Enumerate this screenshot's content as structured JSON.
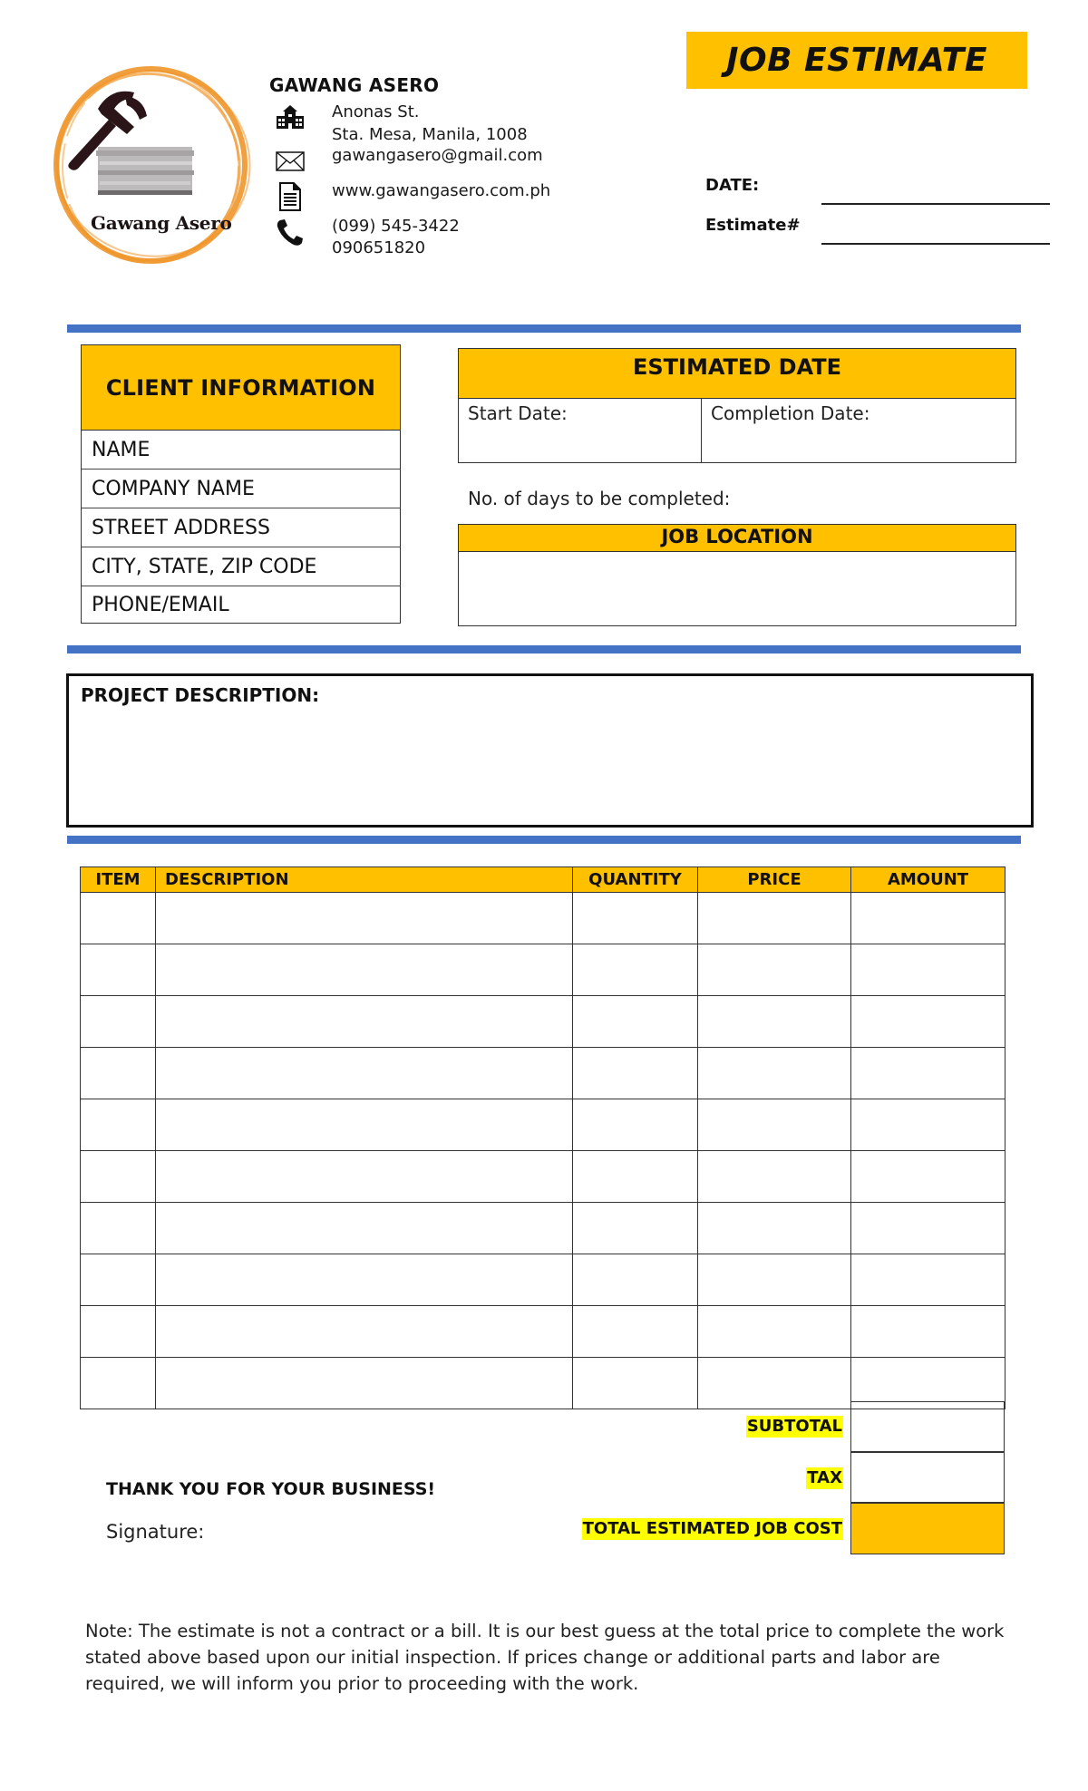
{
  "logo": {
    "text": "Gawang Asero",
    "ring_color": "#F0962A",
    "hammer_color": "#2B1518"
  },
  "company": {
    "name": "GAWANG ASERO",
    "address_line1": "Anonas St.",
    "address_line2": "Sta. Mesa, Manila, 1008",
    "email": "gawangasero@gmail.com",
    "website": "www.gawangasero.com.ph",
    "phone1": "(099) 545-3422",
    "phone2": "090651820",
    "icons": [
      "building-icon",
      "envelope-icon",
      "document-icon",
      "phone-icon"
    ]
  },
  "header": {
    "title": "JOB ESTIMATE",
    "date_label": "DATE:",
    "date_value": "",
    "estimate_label": "Estimate#",
    "estimate_value": ""
  },
  "client_info": {
    "title": "CLIENT INFORMATION",
    "fields": [
      "NAME",
      "COMPANY NAME",
      "STREET ADDRESS",
      "CITY, STATE, ZIP CODE",
      "PHONE/EMAIL"
    ]
  },
  "estimated_date": {
    "title": "ESTIMATED DATE",
    "start_label": "Start Date:",
    "completion_label": "Completion Date:",
    "days_label": "No. of days to be completed:"
  },
  "job_location": {
    "title": "JOB LOCATION",
    "value": ""
  },
  "project": {
    "label": "PROJECT DESCRIPTION:",
    "value": ""
  },
  "items_table": {
    "columns": [
      "ITEM",
      "DESCRIPTION",
      "QUANTITY",
      "PRICE",
      "AMOUNT"
    ],
    "rows": [
      [
        "",
        "",
        "",
        "",
        ""
      ],
      [
        "",
        "",
        "",
        "",
        ""
      ],
      [
        "",
        "",
        "",
        "",
        ""
      ],
      [
        "",
        "",
        "",
        "",
        ""
      ],
      [
        "",
        "",
        "",
        "",
        ""
      ],
      [
        "",
        "",
        "",
        "",
        ""
      ],
      [
        "",
        "",
        "",
        "",
        ""
      ],
      [
        "",
        "",
        "",
        "",
        ""
      ],
      [
        "",
        "",
        "",
        "",
        ""
      ],
      [
        "",
        "",
        "",
        "",
        ""
      ]
    ]
  },
  "totals": {
    "subtotal_label": "SUBTOTAL",
    "subtotal_value": "",
    "tax_label": "TAX",
    "tax_value": "",
    "total_label": "TOTAL ESTIMATED JOB COST",
    "total_value": ""
  },
  "footer": {
    "thanks": "THANK YOU FOR YOUR BUSINESS!",
    "signature_label": "Signature:",
    "note": "Note: The estimate is not a contract or a bill. It is our best guess at the total price to complete the work stated above based upon our initial inspection. If prices change or additional parts and labor are required, we will inform you prior to proceeding with the work."
  },
  "colors": {
    "accent": "#FFC000",
    "rule": "#4472C4",
    "highlight": "#FFFF00"
  }
}
